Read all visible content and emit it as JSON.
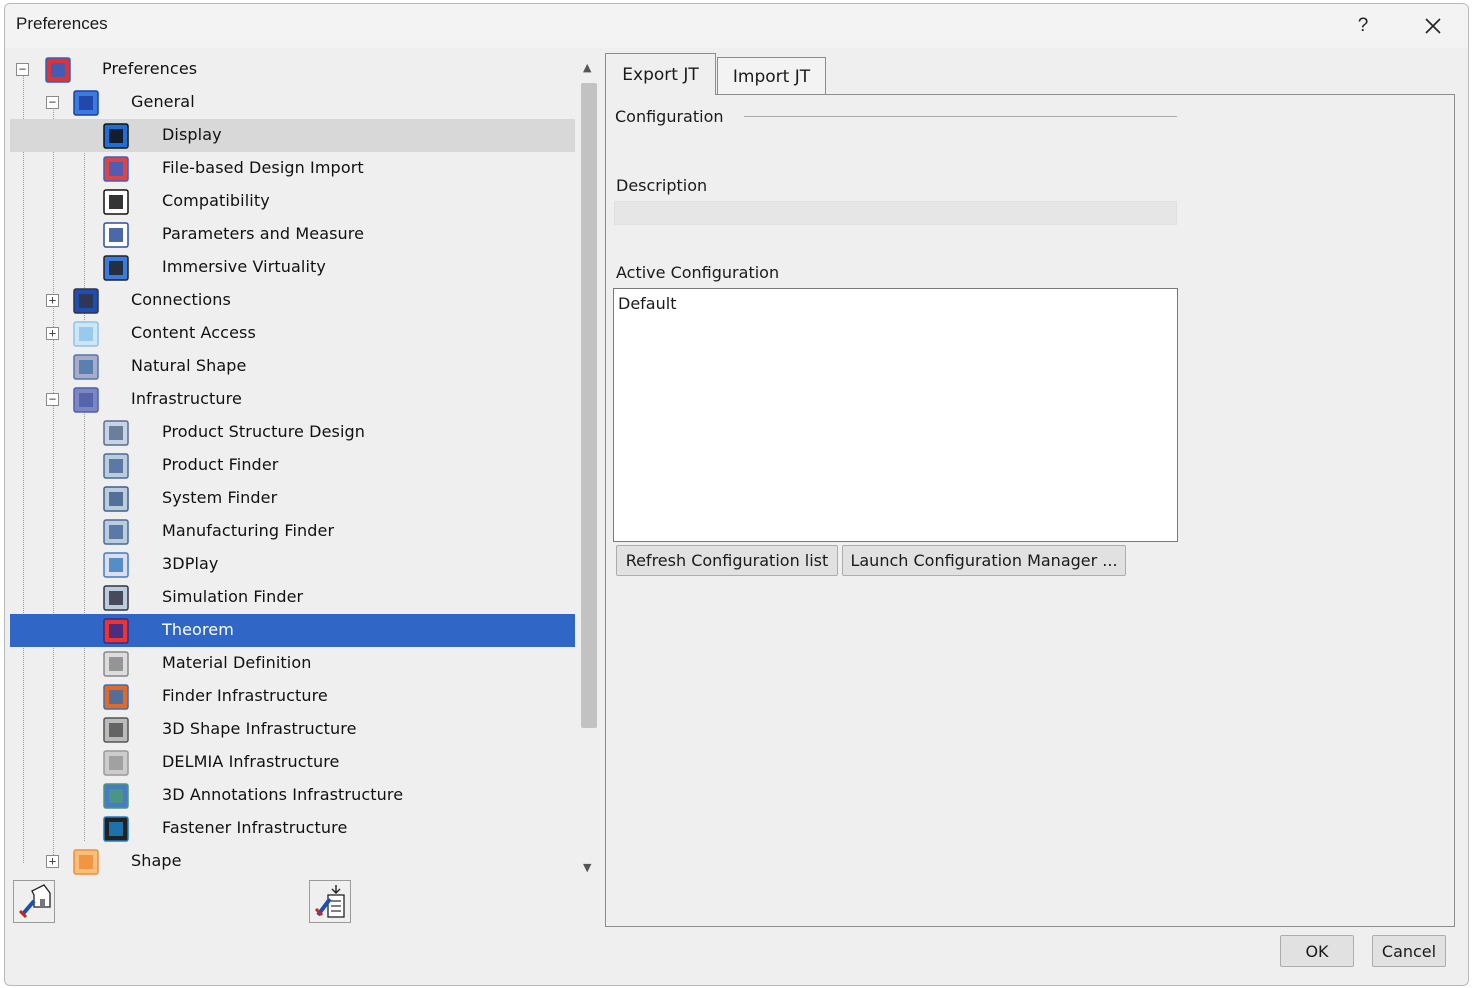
{
  "window": {
    "title": "Preferences",
    "help_label": "?",
    "close_label": "✕"
  },
  "tree": {
    "items": [
      {
        "label": "Preferences",
        "icon": "preferences-icon",
        "level": 0,
        "expander": "minus"
      },
      {
        "label": "General",
        "icon": "general-icon",
        "level": 1,
        "expander": "minus"
      },
      {
        "label": "Display",
        "icon": "display-icon",
        "level": 2,
        "state": "hover"
      },
      {
        "label": "File-based Design Import",
        "icon": "file-import-icon",
        "level": 2
      },
      {
        "label": "Compatibility",
        "icon": "compatibility-icon",
        "level": 2
      },
      {
        "label": "Parameters and Measure",
        "icon": "parameters-icon",
        "level": 2
      },
      {
        "label": "Immersive Virtuality",
        "icon": "immersive-icon",
        "level": 2
      },
      {
        "label": "Connections",
        "icon": "connections-icon",
        "level": 1,
        "expander": "plus"
      },
      {
        "label": "Content Access",
        "icon": "content-access-icon",
        "level": 1,
        "expander": "plus"
      },
      {
        "label": "Natural Shape",
        "icon": "natural-shape-icon",
        "level": 1
      },
      {
        "label": "Infrastructure",
        "icon": "infrastructure-icon",
        "level": 1,
        "expander": "minus"
      },
      {
        "label": "Product Structure Design",
        "icon": "product-structure-icon",
        "level": 2
      },
      {
        "label": "Product Finder",
        "icon": "product-finder-icon",
        "level": 2
      },
      {
        "label": "System Finder",
        "icon": "system-finder-icon",
        "level": 2
      },
      {
        "label": "Manufacturing Finder",
        "icon": "manufacturing-finder-icon",
        "level": 2
      },
      {
        "label": "3DPlay",
        "icon": "3dplay-icon",
        "level": 2
      },
      {
        "label": "Simulation Finder",
        "icon": "simulation-finder-icon",
        "level": 2
      },
      {
        "label": "Theorem",
        "icon": "theorem-icon",
        "level": 2,
        "state": "selected"
      },
      {
        "label": "Material Definition",
        "icon": "material-icon",
        "level": 2
      },
      {
        "label": "Finder Infrastructure",
        "icon": "finder-infra-icon",
        "level": 2
      },
      {
        "label": "3D Shape Infrastructure",
        "icon": "gear-icon",
        "level": 2
      },
      {
        "label": "DELMIA Infrastructure",
        "icon": "delmia-icon",
        "level": 2
      },
      {
        "label": "3D Annotations Infrastructure",
        "icon": "annotations-icon",
        "level": 2
      },
      {
        "label": "Fastener Infrastructure",
        "icon": "fastener-icon",
        "level": 2
      },
      {
        "label": "Shape",
        "icon": "shape-icon",
        "level": 1,
        "expander": "plus"
      }
    ]
  },
  "tabs": {
    "export": "Export JT",
    "import": "Import JT"
  },
  "form": {
    "configuration_label": "Configuration",
    "description_label": "Description",
    "description_value": "",
    "active_configuration_label": "Active Configuration",
    "configurations": [
      "Default"
    ],
    "refresh_button": "Refresh Configuration list",
    "launch_button": "Launch Configuration Manager ..."
  },
  "footer": {
    "ok_label": "OK",
    "cancel_label": "Cancel"
  },
  "colors": {
    "selection": "#3067c6",
    "hover": "#d8d8d8",
    "dialog_bg": "#efefef"
  }
}
